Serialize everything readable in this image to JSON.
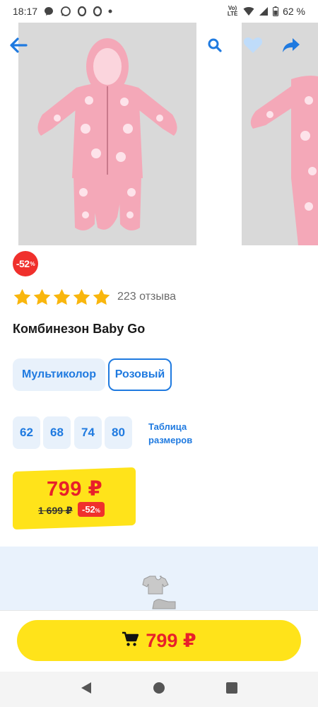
{
  "status_bar": {
    "time": "18:17",
    "network": "Vo) LTE",
    "battery": "62 %"
  },
  "product": {
    "discount_badge": "-52",
    "discount_badge_unit": "%",
    "rating": 5,
    "reviews": "223 отзыва",
    "title": "Комбинезон Baby Go"
  },
  "colors": {
    "options": [
      "Мультиколор",
      "Розовый"
    ],
    "selected": "Розовый"
  },
  "sizes": {
    "options": [
      "62",
      "68",
      "74",
      "80"
    ],
    "table_link_line1": "Таблица",
    "table_link_line2": "размеров"
  },
  "price": {
    "current": "799 ₽",
    "old": "1 699 ₽",
    "discount": "-52",
    "discount_unit": "%"
  },
  "buy_bar": {
    "price": "799 ₽"
  },
  "icons": {
    "back": "arrow-left-icon",
    "search": "search-icon",
    "favorite": "heart-icon",
    "share": "share-icon",
    "cart": "cart-icon"
  },
  "colors_theme": {
    "accent_blue": "#1f7ae0",
    "price_red": "#e8202a",
    "yellow": "#ffe31a",
    "light_blue": "#e8f1fb"
  }
}
